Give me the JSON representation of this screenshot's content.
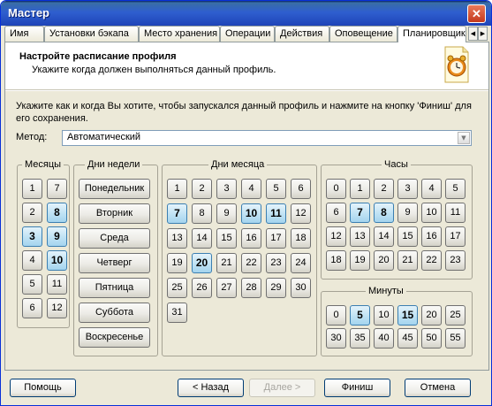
{
  "window": {
    "title": "Мастер",
    "close_glyph": "✕"
  },
  "tabs": [
    {
      "label": "Имя",
      "active": false
    },
    {
      "label": "Установки бэкапа",
      "active": false
    },
    {
      "label": "Место хранения",
      "active": false
    },
    {
      "label": "Операции",
      "active": false
    },
    {
      "label": "Действия",
      "active": false
    },
    {
      "label": "Оповещение",
      "active": false
    },
    {
      "label": "Планировщик",
      "active": true
    }
  ],
  "header": {
    "title": "Настройте расписание профиля",
    "subtitle": "Укажите когда должен выполняться данный профиль.",
    "icon": "alarm-clock-icon"
  },
  "description": "Укажите как и когда Вы хотите, чтобы запускался данный профиль и нажмите на кнопку 'Финиш' для его сохранения.",
  "method": {
    "label": "Метод:",
    "value": "Автоматический"
  },
  "months": {
    "title": "Месяцы",
    "items": [
      "1",
      "2",
      "3",
      "4",
      "5",
      "6",
      "7",
      "8",
      "9",
      "10",
      "11",
      "12"
    ],
    "selected": [
      "3",
      "8",
      "9",
      "10"
    ]
  },
  "weekdays": {
    "title": "Дни недели",
    "items": [
      "Понедельник",
      "Вторник",
      "Среда",
      "Четверг",
      "Пятница",
      "Суббота",
      "Воскресенье"
    ]
  },
  "month_days": {
    "title": "Дни месяца",
    "items": [
      "1",
      "2",
      "3",
      "4",
      "5",
      "6",
      "7",
      "8",
      "9",
      "10",
      "11",
      "12",
      "13",
      "14",
      "15",
      "16",
      "17",
      "18",
      "19",
      "20",
      "21",
      "22",
      "23",
      "24",
      "25",
      "26",
      "27",
      "28",
      "29",
      "30",
      "31"
    ],
    "selected": [
      "7",
      "10",
      "11",
      "20"
    ]
  },
  "hours": {
    "title": "Часы",
    "items": [
      "0",
      "1",
      "2",
      "3",
      "4",
      "5",
      "6",
      "7",
      "8",
      "9",
      "10",
      "11",
      "12",
      "13",
      "14",
      "15",
      "16",
      "17",
      "18",
      "19",
      "20",
      "21",
      "22",
      "23"
    ],
    "selected": [
      "7",
      "8"
    ]
  },
  "minutes": {
    "title": "Минуты",
    "items": [
      "0",
      "5",
      "10",
      "15",
      "20",
      "25",
      "30",
      "35",
      "40",
      "45",
      "50",
      "55"
    ],
    "selected": [
      "5",
      "15"
    ]
  },
  "buttons": {
    "help": "Помощь",
    "back": "< Назад",
    "next": "Далее >",
    "finish": "Финиш",
    "cancel": "Отмена"
  },
  "colors": {
    "title_bar": "#2f5fcf",
    "selected_button": "#bfe2f4",
    "face": "#ece9d8"
  }
}
